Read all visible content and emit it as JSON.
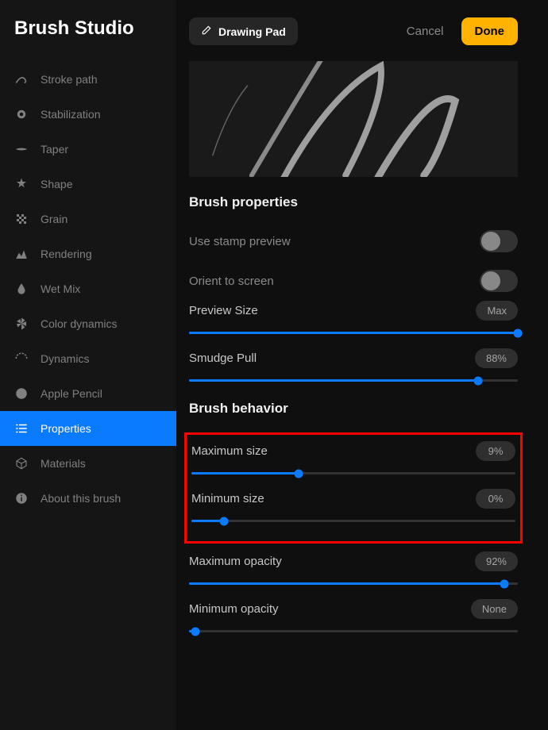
{
  "app_title": "Brush Studio",
  "header": {
    "drawing_pad": "Drawing Pad",
    "cancel": "Cancel",
    "done": "Done"
  },
  "sidebar": {
    "items": [
      {
        "label": "Stroke path"
      },
      {
        "label": "Stabilization"
      },
      {
        "label": "Taper"
      },
      {
        "label": "Shape"
      },
      {
        "label": "Grain"
      },
      {
        "label": "Rendering"
      },
      {
        "label": "Wet Mix"
      },
      {
        "label": "Color dynamics"
      },
      {
        "label": "Dynamics"
      },
      {
        "label": "Apple Pencil"
      },
      {
        "label": "Properties"
      },
      {
        "label": "Materials"
      },
      {
        "label": "About this brush"
      }
    ]
  },
  "sections": {
    "brush_properties": {
      "title": "Brush properties",
      "stamp_preview": "Use stamp preview",
      "orient_screen": "Orient to screen",
      "preview_size": {
        "label": "Preview Size",
        "value": "Max",
        "percent": 100
      },
      "smudge_pull": {
        "label": "Smudge Pull",
        "value": "88%",
        "percent": 88
      }
    },
    "brush_behavior": {
      "title": "Brush behavior",
      "max_size": {
        "label": "Maximum size",
        "value": "9%",
        "percent": 33
      },
      "min_size": {
        "label": "Minimum size",
        "value": "0%",
        "percent": 10
      },
      "max_opacity": {
        "label": "Maximum opacity",
        "value": "92%",
        "percent": 96
      },
      "min_opacity": {
        "label": "Minimum opacity",
        "value": "None",
        "percent": 2
      }
    }
  }
}
